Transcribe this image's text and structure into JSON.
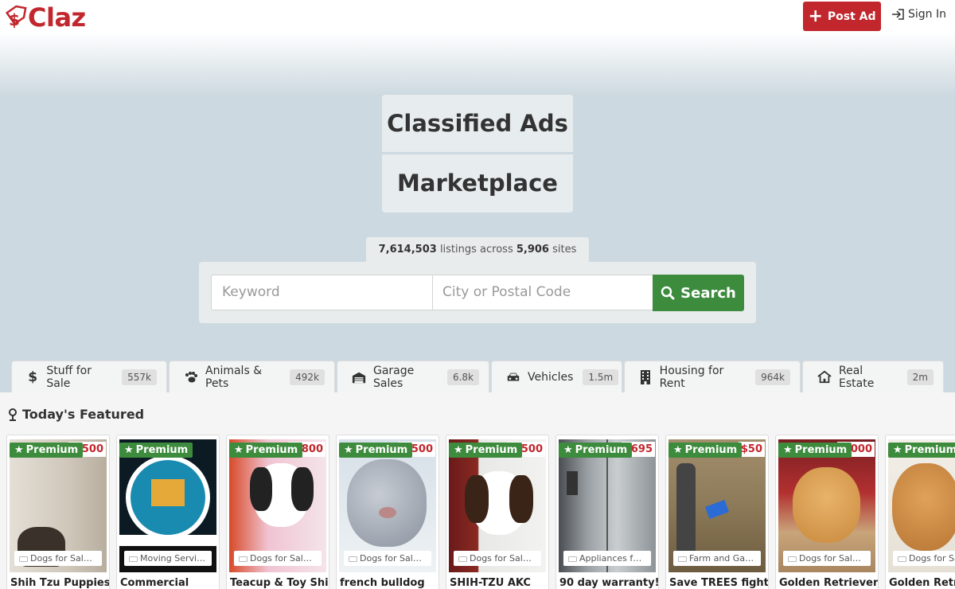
{
  "header": {
    "logo_text": "Claz",
    "post_ad_label": "Post Ad",
    "sign_in_label": "Sign In"
  },
  "hero": {
    "title_line1": "Classified Ads",
    "title_line2": "Marketplace"
  },
  "stats": {
    "listings": "7,614,503",
    "listings_suffix": "listings across",
    "sites": "5,906",
    "sites_suffix": "sites"
  },
  "search": {
    "keyword_placeholder": "Keyword",
    "location_placeholder": "City or Postal Code",
    "button_label": "Search"
  },
  "categories": [
    {
      "icon": "dollar-icon",
      "label": "Stuff for Sale",
      "count": "557k"
    },
    {
      "icon": "paw-icon",
      "label": "Animals & Pets",
      "count": "492k"
    },
    {
      "icon": "garage-icon",
      "label": "Garage Sales",
      "count": "6.8k"
    },
    {
      "icon": "car-icon",
      "label": "Vehicles",
      "count": "1.5m"
    },
    {
      "icon": "building-icon",
      "label": "Housing for Rent",
      "count": "964k"
    },
    {
      "icon": "house-icon",
      "label": "Real Estate",
      "count": "2m"
    }
  ],
  "featured": {
    "heading": "Today's Featured",
    "badge_label": "Premium",
    "items": [
      {
        "price": "1,500",
        "category": "Dogs for Sale ...",
        "title": "Shih Tzu Puppies"
      },
      {
        "price": "",
        "category": "Moving Servic...",
        "title": "Commercial"
      },
      {
        "price": "2,800",
        "category": "Dogs for Sale ...",
        "title": "Teacup & Toy Shih"
      },
      {
        "price": "3,500",
        "category": "Dogs for Sale ...",
        "title": "french bulldog"
      },
      {
        "price": "1,500",
        "category": "Dogs for Sale ...",
        "title": "SHIH-TZU AKC"
      },
      {
        "price": "$695",
        "category": "Appliances for...",
        "title": "90 day warranty!"
      },
      {
        "price": "$50",
        "category": "Farm and Gar...",
        "title": "Save TREES fight"
      },
      {
        "price": "1,000",
        "category": "Dogs for Sale ...",
        "title": "Golden Retriever"
      },
      {
        "price": "",
        "category": "Dogs for Sal",
        "title": "Golden Retrie"
      }
    ]
  },
  "colors": {
    "brand_red": "#c1272d",
    "search_green": "#3d8b3d",
    "hero_bg": "#cdd9e0"
  }
}
